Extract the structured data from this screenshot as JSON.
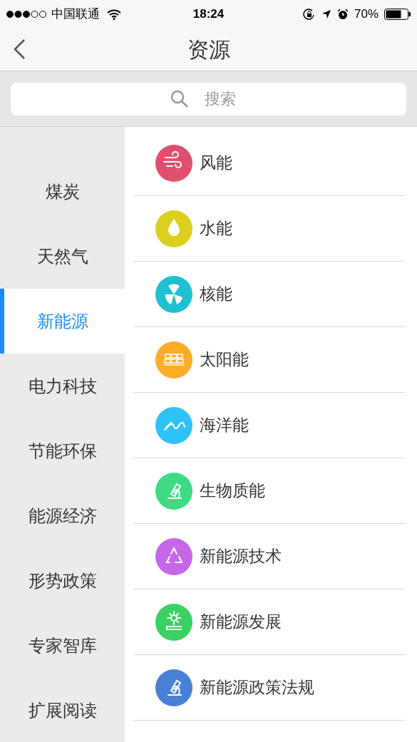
{
  "status_bar": {
    "carrier": "中国联通",
    "time": "18:24",
    "battery": "70%"
  },
  "nav": {
    "title": "资源"
  },
  "search": {
    "placeholder": "搜索"
  },
  "sidebar": {
    "items": [
      {
        "label": "煤炭",
        "selected": false
      },
      {
        "label": "天然气",
        "selected": false
      },
      {
        "label": "新能源",
        "selected": true
      },
      {
        "label": "电力科技",
        "selected": false
      },
      {
        "label": "节能环保",
        "selected": false
      },
      {
        "label": "能源经济",
        "selected": false
      },
      {
        "label": "形势政策",
        "selected": false
      },
      {
        "label": "专家智库",
        "selected": false
      },
      {
        "label": "扩展阅读",
        "selected": false
      }
    ]
  },
  "list": {
    "items": [
      {
        "label": "风能",
        "color": "#e0506e"
      },
      {
        "label": "水能",
        "color": "#dcd01e"
      },
      {
        "label": "核能",
        "color": "#1fc0d0"
      },
      {
        "label": "太阳能",
        "color": "#fdac2a"
      },
      {
        "label": "海洋能",
        "color": "#2fc2f8"
      },
      {
        "label": "生物质能",
        "color": "#3ddc84"
      },
      {
        "label": "新能源技术",
        "color": "#c468e8"
      },
      {
        "label": "新能源发展",
        "color": "#3ad062"
      },
      {
        "label": "新能源政策法规",
        "color": "#4a7fd6"
      }
    ]
  }
}
